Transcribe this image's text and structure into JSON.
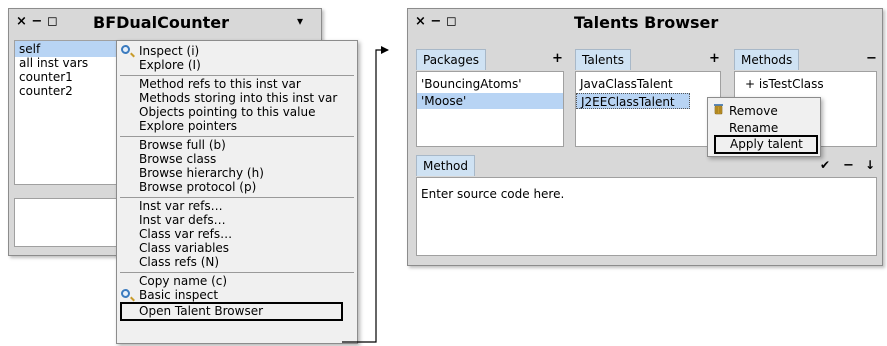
{
  "left_window": {
    "controls": "× − ◻",
    "title": "BFDualCounter",
    "menu_arrow": "▾",
    "list": [
      "self",
      "all inst vars",
      "counter1",
      "counter2"
    ]
  },
  "context_menu": {
    "items": [
      {
        "label": "Inspect (i)",
        "icon": "magnifier-icon"
      },
      {
        "label": "Explore (I)"
      },
      {
        "label": "Method refs to this inst var"
      },
      {
        "label": "Methods storing into this inst var"
      },
      {
        "label": "Objects pointing to this value"
      },
      {
        "label": "Explore pointers"
      },
      {
        "label": "Browse full (b)"
      },
      {
        "label": "Browse class"
      },
      {
        "label": "Browse hierarchy (h)"
      },
      {
        "label": "Browse protocol (p)"
      },
      {
        "label": "Inst var refs…"
      },
      {
        "label": "Inst var defs…"
      },
      {
        "label": "Class var refs…"
      },
      {
        "label": "Class variables"
      },
      {
        "label": "Class refs (N)"
      },
      {
        "label": "Copy name (c)"
      },
      {
        "label": "Basic inspect",
        "icon": "magnifier-icon"
      },
      {
        "label": "Open Talent Browser"
      }
    ]
  },
  "talents_browser": {
    "controls": "× − ◻",
    "title": "Talents Browser",
    "packages": {
      "tab": "Packages",
      "add": "+",
      "items": [
        "'BouncingAtoms'",
        "'Moose'"
      ]
    },
    "talents": {
      "tab": "Talents",
      "add": "+",
      "items": [
        "JavaClassTalent",
        "J2EEClassTalent"
      ]
    },
    "methods": {
      "tab": "Methods",
      "remove": "−",
      "items": [
        "+ isTestClass"
      ]
    },
    "method_pane": {
      "tab": "Method",
      "accept": "✔",
      "minus": "−",
      "down": "↓",
      "placeholder": "Enter source code here."
    },
    "talent_menu": {
      "items": [
        "Remove",
        "Rename",
        "Apply talent"
      ]
    }
  },
  "colors": {
    "selection": "#b8d4f4",
    "tab": "#cfe2f3",
    "window": "#d8d8d8"
  }
}
